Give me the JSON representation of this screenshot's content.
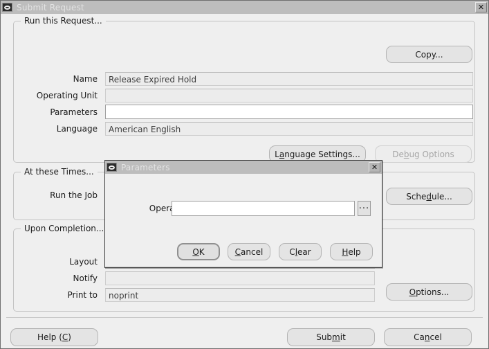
{
  "window": {
    "title": "Submit Request",
    "icon": "oracle-oval-icon",
    "close_label": "✕"
  },
  "groups": {
    "run_this_request": {
      "title": "Run this Request..."
    },
    "at_these_times": {
      "title": "At these Times..."
    },
    "upon_completion": {
      "title": "Upon Completion..."
    }
  },
  "fields": {
    "name": {
      "label": "Name",
      "value": "Release Expired Hold",
      "editable": false
    },
    "operating_unit": {
      "label": "Operating Unit",
      "value": "",
      "editable": false
    },
    "parameters": {
      "label": "Parameters",
      "value": "",
      "editable": true
    },
    "language": {
      "label": "Language",
      "value": "American English",
      "editable": false
    },
    "run_the_job": {
      "label": "Run the Job",
      "value": ""
    },
    "layout": {
      "label": "Layout",
      "value": ""
    },
    "notify": {
      "label": "Notify",
      "value": ""
    },
    "print_to": {
      "label": "Print to",
      "value": "noprint"
    }
  },
  "buttons": {
    "copy": {
      "label": "Copy...",
      "mnemonic": "",
      "disabled": false
    },
    "language_settings": {
      "pre": "L",
      "mnemonic": "a",
      "post": "nguage Settings...",
      "disabled": false
    },
    "debug_options": {
      "pre": "De",
      "mnemonic": "b",
      "post": "ug Options",
      "disabled": true
    },
    "schedule": {
      "pre": "Sche",
      "mnemonic": "d",
      "post": "ule...",
      "disabled": false
    },
    "options": {
      "pre": "",
      "mnemonic": "O",
      "post": "ptions...",
      "disabled": false
    },
    "help_c": {
      "pre": "Help (",
      "mnemonic": "C",
      "post": ")",
      "disabled": false
    },
    "submit": {
      "pre": "Sub",
      "mnemonic": "m",
      "post": "it",
      "disabled": false
    },
    "cancel": {
      "pre": "Ca",
      "mnemonic": "n",
      "post": "cel",
      "disabled": false
    }
  },
  "dialog": {
    "title": "Parameters",
    "icon": "oracle-oval-icon",
    "close_label": "✕",
    "field": {
      "label": "Operating Unit",
      "value": "",
      "placeholder": ""
    },
    "lov_button": {
      "label": "..."
    },
    "buttons": {
      "ok": {
        "pre": "",
        "mnemonic": "O",
        "post": "K",
        "default": true
      },
      "cancel": {
        "pre": "",
        "mnemonic": "C",
        "post": "ancel",
        "default": false
      },
      "clear": {
        "pre": "C",
        "mnemonic": "l",
        "post": "ear",
        "default": false
      },
      "help": {
        "pre": "",
        "mnemonic": "H",
        "post": "elp",
        "default": false
      }
    }
  },
  "colors": {
    "window_bg": "#efefef",
    "titlebar_bg": "#bdbdbd",
    "titlebar_text": "#e3e3e3",
    "field_readonly_bg": "#ececec",
    "field_editable_bg": "#ffffff",
    "button_bg": "#e4e4e4",
    "disabled_text": "#a6a6a6",
    "border": "#c3c3c3"
  }
}
